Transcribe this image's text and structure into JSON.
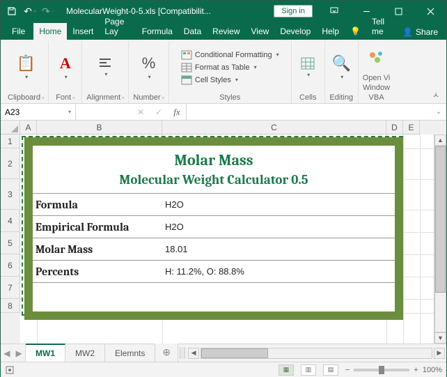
{
  "title": "MolecularWeight-0-5.xls [Compatibilit...",
  "signin": "Sign in",
  "tabs": {
    "file": "File",
    "home": "Home",
    "insert": "Insert",
    "pagelayout": "Page Lay",
    "formulas": "Formula",
    "data": "Data",
    "review": "Review",
    "view": "View",
    "developer": "Develop",
    "help": "Help",
    "tellme": "Tell me",
    "share": "Share"
  },
  "groups": {
    "clipboard": "Clipboard",
    "font": "Font",
    "alignment": "Alignment",
    "number": "Number",
    "styles": "Styles",
    "cells": "Cells",
    "editing": "Editing",
    "openvba": "Open Vi",
    "openvba2": "Window",
    "openvba3": "VBA"
  },
  "styleBtns": {
    "cond": "Conditional Formatting",
    "table": "Format as Table",
    "cell": "Cell Styles"
  },
  "namebox": "A23",
  "cols": [
    "A",
    "B",
    "C",
    "D",
    "E"
  ],
  "rows": [
    "1",
    "2",
    "3",
    "4",
    "5",
    "6",
    "7",
    "8"
  ],
  "banner": {
    "title": "Molar Mass",
    "subtitle": "Molecular Weight Calculator 0.5",
    "r1l": "Formula",
    "r1v": "H2O",
    "r2l": "Empirical Formula",
    "r2v": "H2O",
    "r3l": "Molar Mass",
    "r3v": "18.01",
    "r4l": "Percents",
    "r4v": "H: 11.2%, O: 88.8%"
  },
  "sheets": {
    "s1": "MW1",
    "s2": "MW2",
    "s3": "Elemnts"
  },
  "zoom": "100%"
}
